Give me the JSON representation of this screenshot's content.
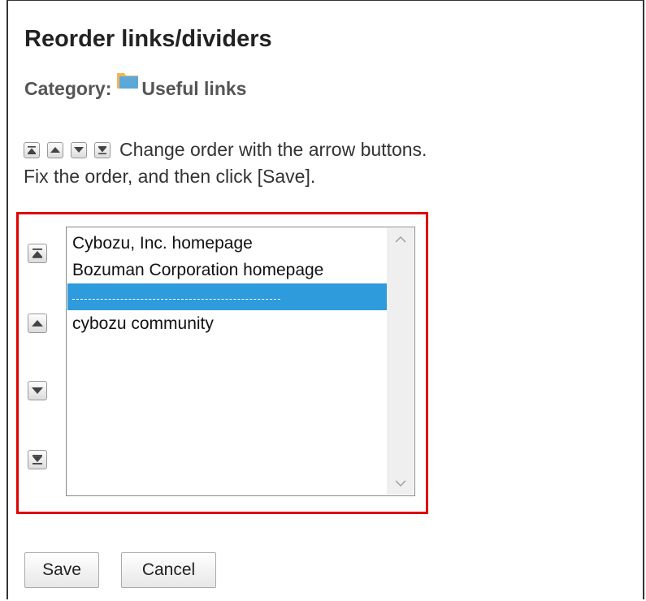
{
  "header": {
    "title": "Reorder links/dividers"
  },
  "category": {
    "label": "Category:",
    "name": "Useful links",
    "icon": "folder-icon"
  },
  "instructions": {
    "line1": "Change order with the arrow buttons.",
    "line2": "Fix the order, and then click [Save]."
  },
  "list": {
    "items": [
      {
        "label": "Cybozu, Inc. homepage",
        "selected": false
      },
      {
        "label": "Bozuman Corporation homepage",
        "selected": false
      },
      {
        "label": "",
        "selected": true,
        "is_divider": true
      },
      {
        "label": "cybozu community",
        "selected": false
      }
    ]
  },
  "move_buttons": [
    "move-to-top",
    "move-up",
    "move-down",
    "move-to-bottom"
  ],
  "actions": {
    "save_label": "Save",
    "cancel_label": "Cancel"
  },
  "colors": {
    "highlight_border": "#e00000",
    "selected_bg": "#2e9bdc",
    "folder": "#f0b65a"
  }
}
